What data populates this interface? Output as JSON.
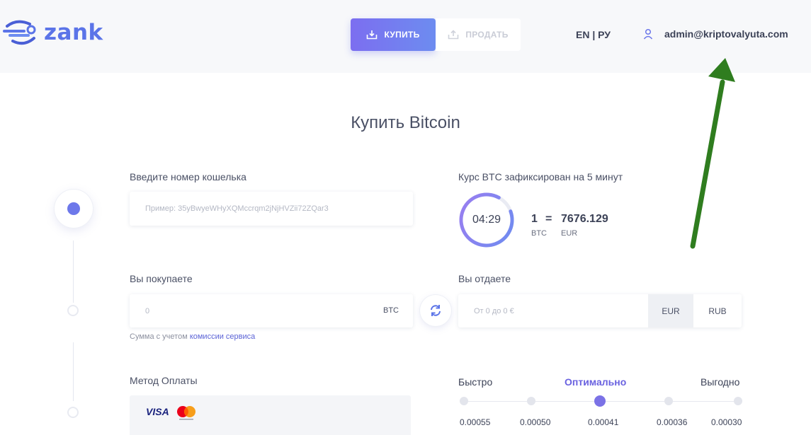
{
  "brand": {
    "name": "zank",
    "accent": "#6d78ea"
  },
  "header": {
    "buy_label": "КУПИТЬ",
    "sell_label": "ПРОДАТЬ",
    "lang_en": "EN",
    "lang_sep": "|",
    "lang_ru": "РУ",
    "user_email": "admin@kriptovalyuta.com"
  },
  "page": {
    "title": "Купить Bitcoin"
  },
  "wallet": {
    "label": "Введите номер кошелька",
    "placeholder": "Пример: 35yBwyeWHyXQMccrqm2jNjHVZii72ZQar3"
  },
  "rate": {
    "label": "Курс BTC зафиксирован на 5 минут",
    "timer": "04:29",
    "left_amount": "1",
    "equals": "=",
    "right_amount": "7676.129",
    "left_currency": "BTC",
    "right_currency": "EUR"
  },
  "buy": {
    "label": "Вы покупаете",
    "placeholder": "0",
    "currency": "BTC",
    "hint_prefix": "Сумма с учетом ",
    "hint_link": "комиссии сервиса"
  },
  "give": {
    "label": "Вы отдаете",
    "placeholder": "От 0 до 0 €",
    "currencies": [
      "EUR",
      "RUB"
    ],
    "selected": "EUR"
  },
  "payment": {
    "label": "Метод Оплаты",
    "visa": "VISA"
  },
  "fee": {
    "labels": {
      "fast": "Быстро",
      "optimal": "Оптимально",
      "cheap": "Выгодно"
    },
    "values": [
      "0.00055",
      "0.00050",
      "0.00041",
      "0.00036",
      "0.00030"
    ],
    "selected_index": 2,
    "accent": "#7b72e6"
  }
}
